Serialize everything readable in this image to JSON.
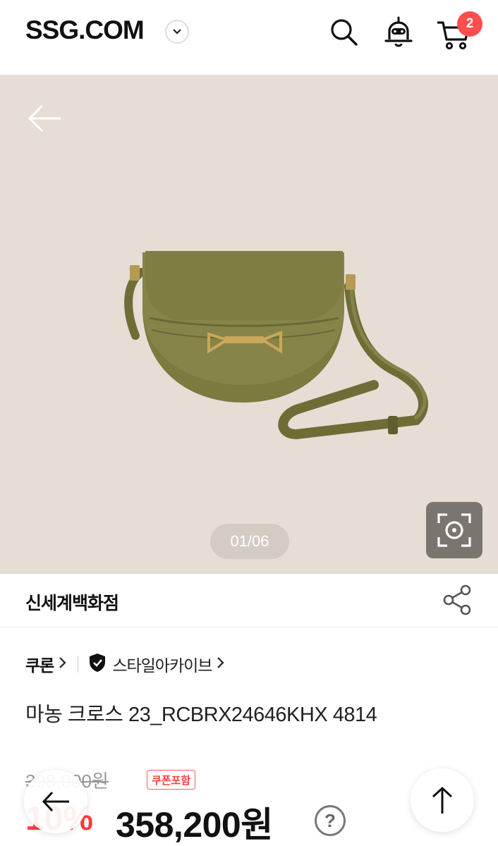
{
  "header": {
    "logo": "SSG.COM",
    "cart_count": "2"
  },
  "hero": {
    "image_counter": "01/06"
  },
  "seller": {
    "name": "신세계백화점"
  },
  "brand": {
    "name": "쿠론",
    "shop": "스타일아카이브"
  },
  "product": {
    "title": "마농 크로스 23_RCBRX24646KHX 4814",
    "original_price": "398,000원",
    "coupon_label": "쿠폰포함",
    "discount": "10%",
    "sale_price": "358,200원",
    "help": "?"
  },
  "colors": {
    "accent": "#ff3c3c",
    "hero_bg": "#e6ddd5",
    "bag": "#7c7a3f"
  }
}
